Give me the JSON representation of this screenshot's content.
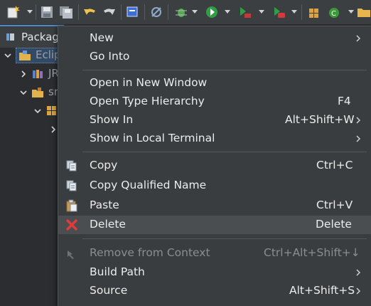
{
  "panel": {
    "tab_label": "Package",
    "tree": [
      {
        "label": "Eclip"
      },
      {
        "label": "JR"
      },
      {
        "label": "sr"
      }
    ]
  },
  "menu": {
    "items": [
      {
        "label": "New",
        "shortcut": "",
        "submenu": true
      },
      {
        "label": "Go Into",
        "shortcut": "",
        "submenu": false
      },
      {
        "label": "Open in New Window",
        "shortcut": "",
        "submenu": false
      },
      {
        "label": "Open Type Hierarchy",
        "shortcut": "F4",
        "submenu": false
      },
      {
        "label": "Show In",
        "shortcut": "Alt+Shift+W",
        "submenu": true
      },
      {
        "label": "Show in Local Terminal",
        "shortcut": "",
        "submenu": true
      },
      {
        "label": "Copy",
        "shortcut": "Ctrl+C",
        "icon": "copy-icon"
      },
      {
        "label": "Copy Qualified Name",
        "shortcut": "",
        "icon": "copy-qualified-name-icon"
      },
      {
        "label": "Paste",
        "shortcut": "Ctrl+V",
        "icon": "paste-icon"
      },
      {
        "label": "Delete",
        "shortcut": "Delete",
        "icon": "delete-icon"
      },
      {
        "label": "Remove from Context",
        "shortcut": "Ctrl+Alt+Shift+↓",
        "icon": "remove-from-context-icon",
        "disabled": true
      },
      {
        "label": "Build Path",
        "shortcut": "",
        "submenu": true
      },
      {
        "label": "Source",
        "shortcut": "Alt+Shift+S",
        "submenu": true
      }
    ]
  },
  "colors": {
    "menu_bg": "#3a3d3f",
    "highlight": "#4b4e50",
    "delete_red": "#e03c3c"
  }
}
